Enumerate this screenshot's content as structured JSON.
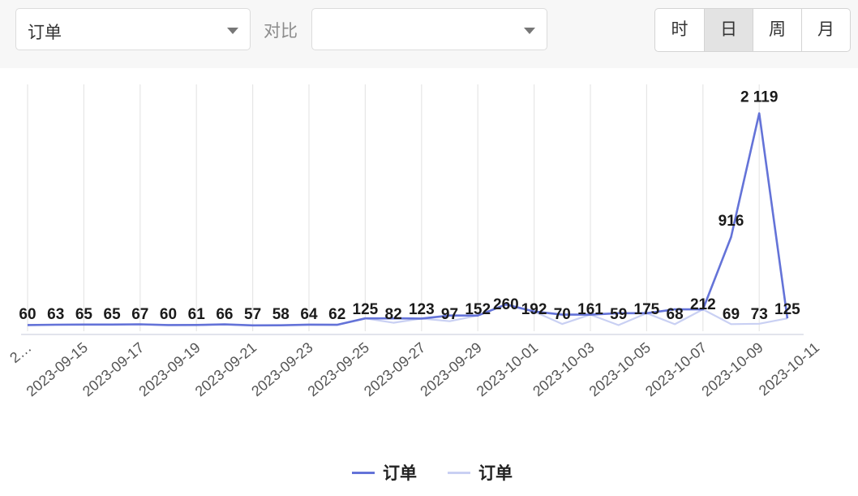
{
  "toolbar": {
    "metric_select": {
      "value": "订单"
    },
    "compare_label": "对比",
    "compare_select": {
      "value": ""
    },
    "granularity": {
      "options": [
        "时",
        "日",
        "周",
        "月"
      ],
      "selected": "日"
    }
  },
  "colors": {
    "primary": "#6473d8",
    "compare": "#c9d0f3",
    "grid": "#e6e6e6",
    "toolbar_bg": "#f7f7f7"
  },
  "chart_data": {
    "type": "line",
    "x_tick_labels": [
      "2…",
      "2023-09-15",
      "2023-09-17",
      "2023-09-19",
      "2023-09-21",
      "2023-09-23",
      "2023-09-25",
      "2023-09-27",
      "2023-09-29",
      "2023-10-01",
      "2023-10-03",
      "2023-10-05",
      "2023-10-07",
      "2023-10-09",
      "2023-10-11"
    ],
    "series": [
      {
        "name": "订单",
        "values": [
          60,
          63,
          65,
          65,
          67,
          60,
          61,
          66,
          57,
          58,
          64,
          62,
          125,
          82,
          123,
          97,
          152,
          260,
          192,
          70,
          161,
          59,
          175,
          68,
          212,
          69,
          73,
          125
        ],
        "labels": [
          "60",
          "63",
          "65",
          "65",
          "67",
          "60",
          "61",
          "66",
          "57",
          "58",
          "64",
          "62",
          "125",
          "82",
          "123",
          "97",
          "152",
          "260",
          "192",
          "70",
          "161",
          "59",
          "175",
          "68",
          "212",
          "69",
          "73",
          "125"
        ]
      },
      {
        "name": "订单",
        "values": [
          60,
          63,
          65,
          65,
          67,
          60,
          61,
          66,
          57,
          58,
          64,
          62,
          125,
          125,
          123,
          152,
          152,
          260,
          192,
          161,
          161,
          175,
          175,
          212,
          212,
          916,
          2119,
          125
        ],
        "labels": [
          "",
          "",
          "",
          "",
          "",
          "",
          "",
          "",
          "",
          "",
          "",
          "",
          "",
          "",
          "",
          "",
          "",
          "",
          "",
          "",
          "",
          "",
          "",
          "",
          "",
          "916",
          "2 119",
          ""
        ]
      }
    ],
    "ylim": [
      0,
      2400
    ],
    "grid": true,
    "legend": "bottom-center"
  }
}
